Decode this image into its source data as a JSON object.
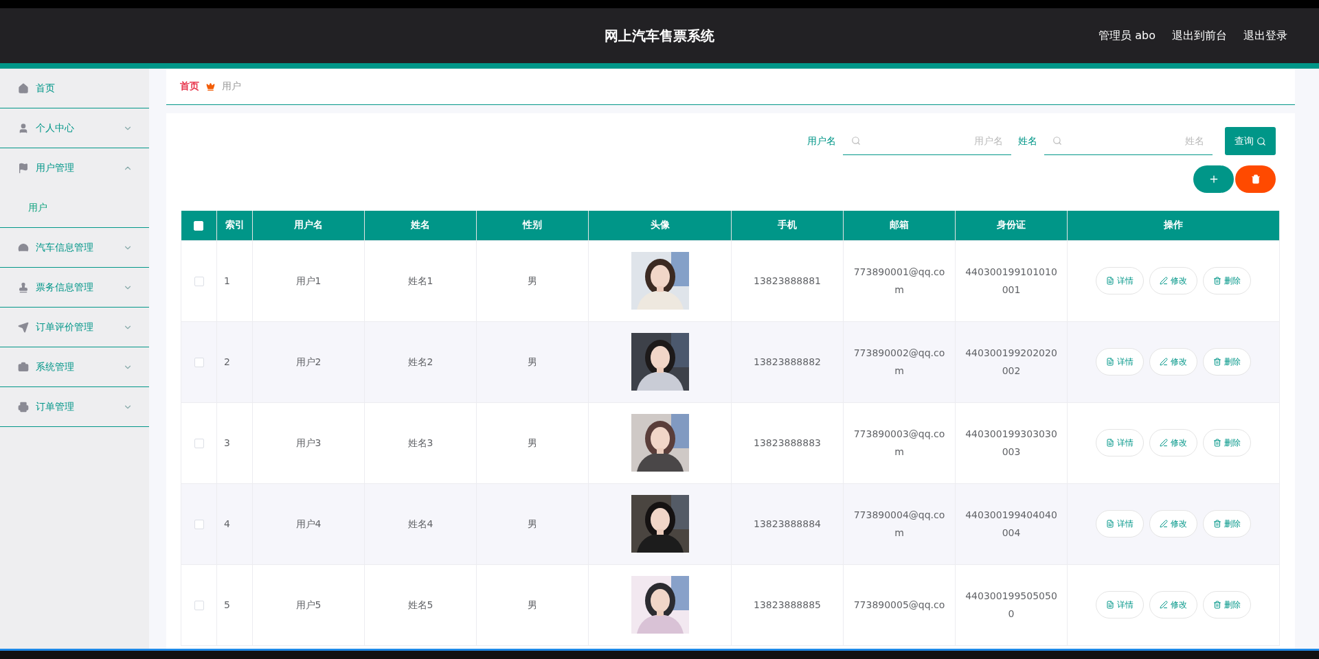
{
  "header": {
    "title": "网上汽车售票系统",
    "links": [
      "管理员 abo",
      "退出到前台",
      "退出登录"
    ]
  },
  "sidebar": {
    "items": [
      {
        "label": "首页",
        "kind": "link"
      },
      {
        "label": "个人中心",
        "kind": "menu",
        "expanded": false
      },
      {
        "label": "用户管理",
        "kind": "menu",
        "expanded": true,
        "children": [
          {
            "label": "用户"
          }
        ]
      },
      {
        "label": "汽车信息管理",
        "kind": "menu",
        "expanded": false
      },
      {
        "label": "票务信息管理",
        "kind": "menu",
        "expanded": false
      },
      {
        "label": "订单评价管理",
        "kind": "menu",
        "expanded": false
      },
      {
        "label": "系统管理",
        "kind": "menu",
        "expanded": false
      },
      {
        "label": "订单管理",
        "kind": "menu",
        "expanded": false
      }
    ]
  },
  "breadcrumb": {
    "home": "首页",
    "current": "用户"
  },
  "search": {
    "fields": [
      {
        "label": "用户名",
        "placeholder": "用户名"
      },
      {
        "label": "姓名",
        "placeholder": "姓名"
      }
    ],
    "button": "查询"
  },
  "table": {
    "select_all_checked": false,
    "columns": [
      "索引",
      "用户名",
      "姓名",
      "性别",
      "头像",
      "手机",
      "邮箱",
      "身份证",
      "操作"
    ],
    "rows": [
      {
        "checked": false,
        "index": "1",
        "username": "用户1",
        "name": "姓名1",
        "gender": "男",
        "phone": "13823888881",
        "email": "773890001@qq.com",
        "id_card": "440300199101010001",
        "actions": [
          "详情",
          "修改",
          "删除"
        ]
      },
      {
        "checked": false,
        "index": "2",
        "username": "用户2",
        "name": "姓名2",
        "gender": "男",
        "phone": "13823888882",
        "email": "773890002@qq.com",
        "id_card": "440300199202020002",
        "actions": [
          "详情",
          "修改",
          "删除"
        ]
      },
      {
        "checked": false,
        "index": "3",
        "username": "用户3",
        "name": "姓名3",
        "gender": "男",
        "phone": "13823888883",
        "email": "773890003@qq.com",
        "id_card": "440300199303030003",
        "actions": [
          "详情",
          "修改",
          "删除"
        ]
      },
      {
        "checked": false,
        "index": "4",
        "username": "用户4",
        "name": "姓名4",
        "gender": "男",
        "phone": "13823888884",
        "email": "773890004@qq.com",
        "id_card": "440300199404040004",
        "actions": [
          "详情",
          "修改",
          "删除"
        ]
      },
      {
        "checked": false,
        "index": "5",
        "username": "用户5",
        "name": "姓名5",
        "gender": "男",
        "phone": "13823888885",
        "email": "773890005@qq.co",
        "id_card": "4403001995050500",
        "actions": [
          "详情",
          "修改",
          "删除"
        ]
      }
    ]
  }
}
